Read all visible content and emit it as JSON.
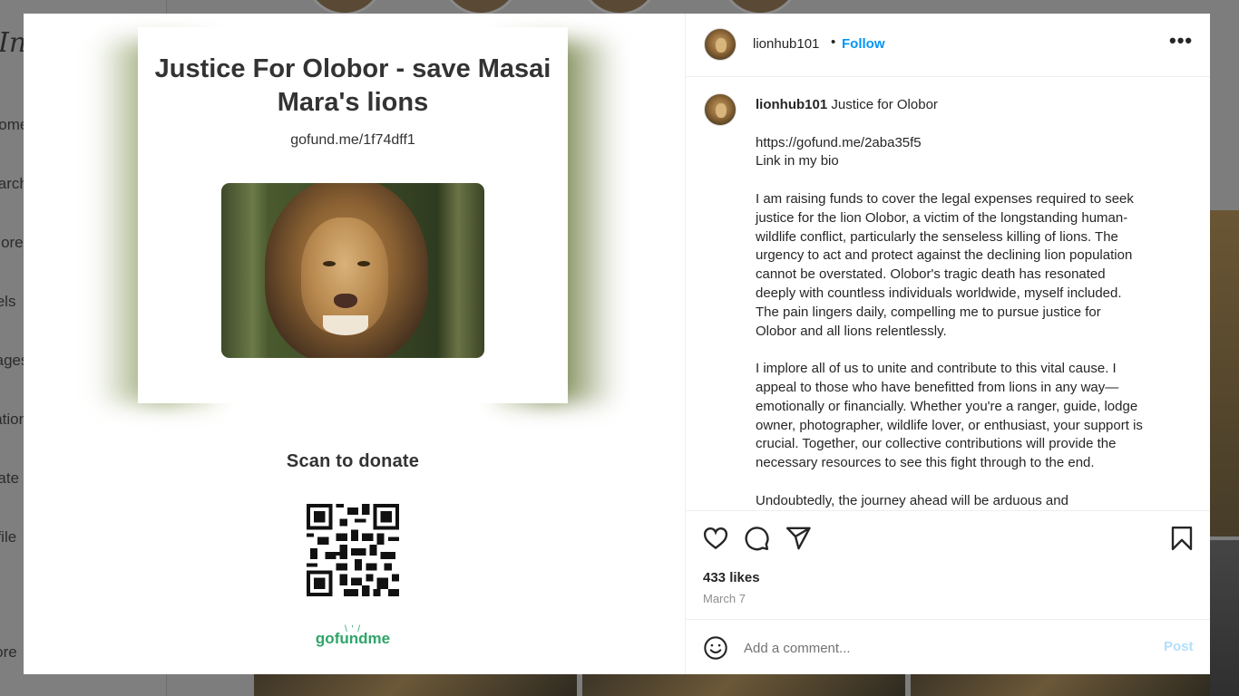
{
  "background": {
    "logo": "Instagram",
    "nav_items": [
      "Home",
      "Search",
      "Explore",
      "Reels",
      "Messages",
      "Notifications",
      "Create",
      "Profile",
      "More"
    ]
  },
  "media": {
    "card_title": "Justice For Olobor - save Masai Mara's lions",
    "card_url": "gofund.me/1f74dff1",
    "scan_label": "Scan to donate",
    "brand_logo": "gofundme"
  },
  "header": {
    "username": "lionhub101",
    "separator": "•",
    "follow_label": "Follow",
    "more_icon": "more-horizontal-icon"
  },
  "caption": {
    "username": "lionhub101",
    "title": "Justice for Olobor",
    "lines": [
      "https://gofund.me/2aba35f5",
      "Link in my bio",
      "",
      "I am raising funds to cover the legal expenses required to seek",
      "justice for the lion Olobor, a victim of the longstanding human-",
      "wildlife conflict, particularly the senseless killing of lions. The",
      "urgency to act and protect against the declining lion population",
      "cannot be overstated. Olobor's tragic death has resonated",
      "deeply with countless individuals worldwide, myself included.",
      "The pain lingers daily, compelling me to pursue justice for",
      "Olobor and all lions relentlessly.",
      "",
      "I implore all of us to unite and contribute to this vital cause. I",
      "appeal to those who have benefitted from lions in any way—",
      "emotionally or financially. Whether you're a ranger, guide, lodge",
      "owner, photographer, wildlife lover, or enthusiast, your support is",
      "crucial. Together, our collective contributions will provide the",
      "necessary resources to see this fight through to the end.",
      "",
      "Undoubtedly, the journey ahead will be arduous and"
    ]
  },
  "actions": {
    "icons": [
      "heart-icon",
      "comment-icon",
      "share-icon",
      "bookmark-icon"
    ],
    "likes": "433 likes",
    "date": "March 7"
  },
  "comment": {
    "placeholder": "Add a comment...",
    "post_label": "Post"
  },
  "colors": {
    "accent": "#0095f6",
    "post_disabled": "#b2dffc",
    "gofundme_green": "#2ea56a",
    "overlay": "#7a7a7a"
  }
}
